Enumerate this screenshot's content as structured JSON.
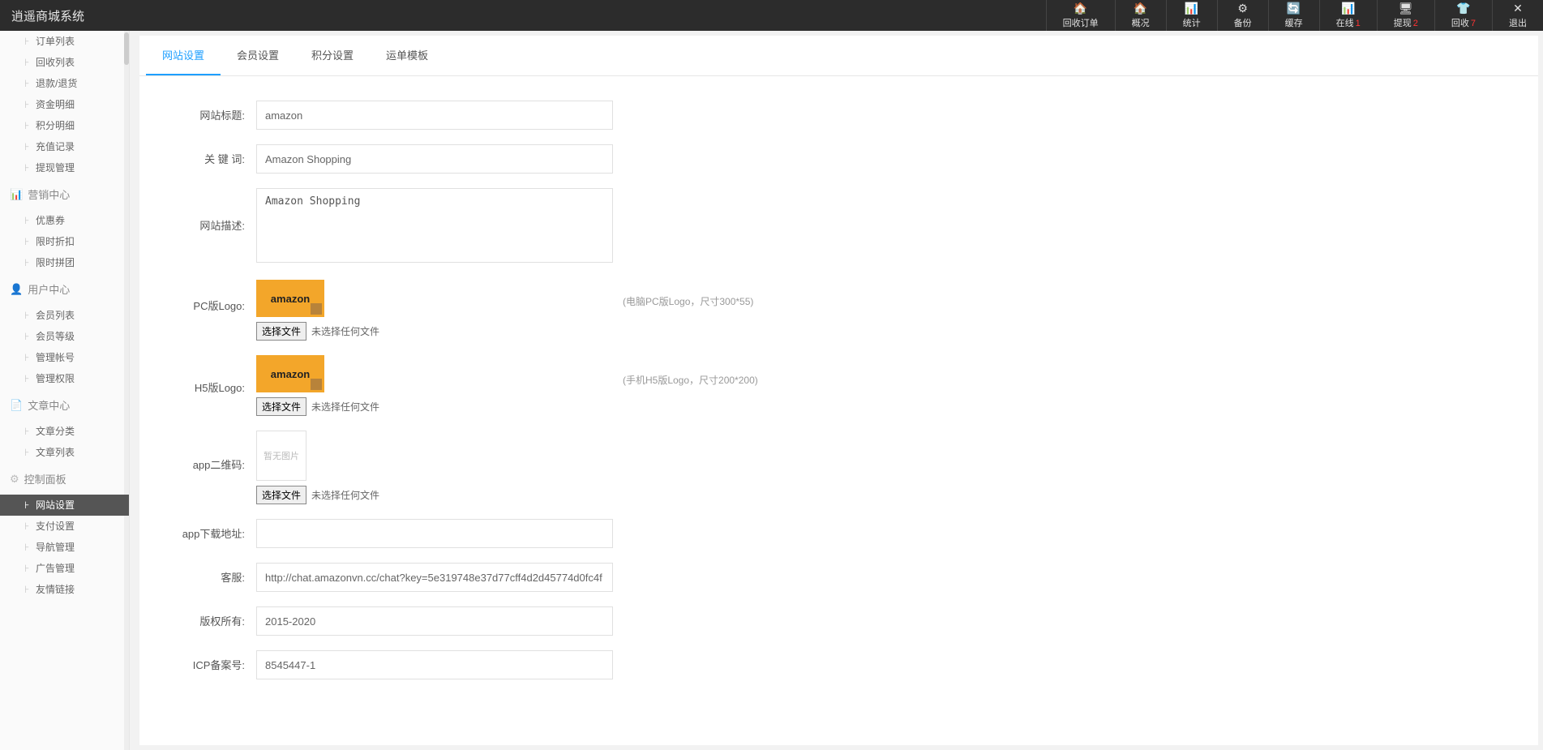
{
  "header": {
    "title": "逍遥商城系统",
    "items": [
      {
        "icon": "🏠",
        "label": "回收订单",
        "badge": ""
      },
      {
        "icon": "🏠",
        "label": "概况",
        "badge": ""
      },
      {
        "icon": "📊",
        "label": "统计",
        "badge": ""
      },
      {
        "icon": "⚙",
        "label": "备份",
        "badge": ""
      },
      {
        "icon": "🔄",
        "label": "缓存",
        "badge": ""
      },
      {
        "icon": "📊",
        "label": "在线",
        "badge": "1"
      },
      {
        "icon": "🖥",
        "label": "提现",
        "badge": "2"
      },
      {
        "icon": "👕",
        "label": "回收",
        "badge": "7"
      },
      {
        "icon": "✕",
        "label": "退出",
        "badge": ""
      }
    ]
  },
  "sidebar": {
    "groups": [
      {
        "title": "",
        "icon": "",
        "items": [
          {
            "label": "订单列表",
            "active": false
          },
          {
            "label": "回收列表",
            "active": false
          },
          {
            "label": "退款/退货",
            "active": false
          },
          {
            "label": "资金明细",
            "active": false
          },
          {
            "label": "积分明细",
            "active": false
          },
          {
            "label": "充值记录",
            "active": false
          },
          {
            "label": "提现管理",
            "active": false
          }
        ]
      },
      {
        "title": "营销中心",
        "icon": "📊",
        "items": [
          {
            "label": "优惠券",
            "active": false
          },
          {
            "label": "限时折扣",
            "active": false
          },
          {
            "label": "限时拼团",
            "active": false
          }
        ]
      },
      {
        "title": "用户中心",
        "icon": "👤",
        "items": [
          {
            "label": "会员列表",
            "active": false
          },
          {
            "label": "会员等级",
            "active": false
          },
          {
            "label": "管理帐号",
            "active": false
          },
          {
            "label": "管理权限",
            "active": false
          }
        ]
      },
      {
        "title": "文章中心",
        "icon": "📄",
        "items": [
          {
            "label": "文章分类",
            "active": false
          },
          {
            "label": "文章列表",
            "active": false
          }
        ]
      },
      {
        "title": "控制面板",
        "icon": "⚙",
        "items": [
          {
            "label": "网站设置",
            "active": true
          },
          {
            "label": "支付设置",
            "active": false
          },
          {
            "label": "导航管理",
            "active": false
          },
          {
            "label": "广告管理",
            "active": false
          },
          {
            "label": "友情链接",
            "active": false
          }
        ]
      }
    ]
  },
  "tabs": [
    {
      "label": "网站设置",
      "active": true
    },
    {
      "label": "会员设置",
      "active": false
    },
    {
      "label": "积分设置",
      "active": false
    },
    {
      "label": "运单模板",
      "active": false
    }
  ],
  "form": {
    "siteTitle": {
      "label": "网站标题:",
      "value": "amazon"
    },
    "keywords": {
      "label": "关 键 词:",
      "value": "Amazon Shopping"
    },
    "desc": {
      "label": "网站描述:",
      "value": "Amazon Shopping"
    },
    "pcLogo": {
      "label": "PC版Logo:",
      "btn": "选择文件",
      "noFile": "未选择任何文件",
      "hint": "(电脑PC版Logo，尺寸300*55)",
      "preview": "amazon"
    },
    "h5Logo": {
      "label": "H5版Logo:",
      "btn": "选择文件",
      "noFile": "未选择任何文件",
      "hint": "(手机H5版Logo，尺寸200*200)",
      "preview": "amazon"
    },
    "qr": {
      "label": "app二维码:",
      "btn": "选择文件",
      "noFile": "未选择任何文件",
      "placeholder": "暂无图片"
    },
    "appUrl": {
      "label": "app下载地址:",
      "value": ""
    },
    "kefu": {
      "label": "客服:",
      "value": "http://chat.amazonvn.cc/chat?key=5e319748e37d77cff4d2d45774d0fc4f"
    },
    "copyright": {
      "label": "版权所有:",
      "value": "2015-2020"
    },
    "icp": {
      "label": "ICP备案号:",
      "value": "8545447-1"
    }
  }
}
